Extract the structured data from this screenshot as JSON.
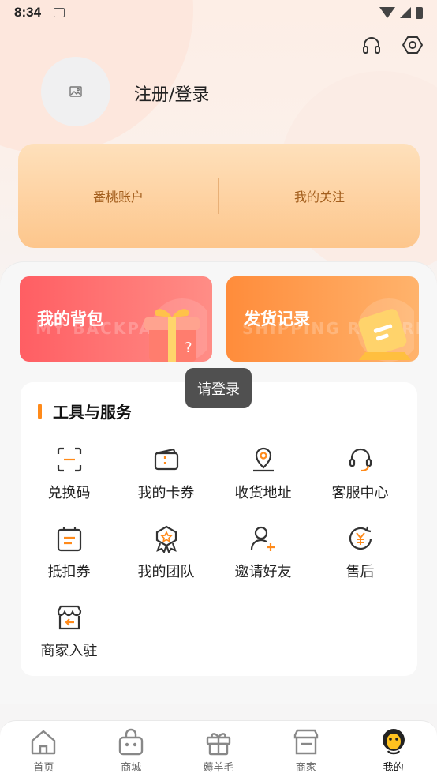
{
  "status_bar": {
    "time": "8:34"
  },
  "profile": {
    "login_label": "注册/登录"
  },
  "account_card": {
    "items": [
      "番桃账户",
      "我的关注"
    ]
  },
  "promos": {
    "backpack": {
      "title": "我的背包",
      "watermark": "MY BACKPACK"
    },
    "shipping": {
      "title": "发货记录",
      "watermark": "SHIPPING RECORD"
    }
  },
  "toast": "请登录",
  "tools": {
    "title": "工具与服务",
    "items": [
      {
        "label": "兑换码",
        "icon": "scan-code-icon"
      },
      {
        "label": "我的卡券",
        "icon": "ticket-icon"
      },
      {
        "label": "收货地址",
        "icon": "location-pin-icon"
      },
      {
        "label": "客服中心",
        "icon": "headset-icon"
      },
      {
        "label": "抵扣券",
        "icon": "calendar-voucher-icon"
      },
      {
        "label": "我的团队",
        "icon": "badge-team-icon"
      },
      {
        "label": "邀请好友",
        "icon": "add-user-icon"
      },
      {
        "label": "售后",
        "icon": "refund-yen-icon"
      },
      {
        "label": "商家入驻",
        "icon": "shop-enter-icon"
      }
    ]
  },
  "tabbar": {
    "items": [
      {
        "label": "首页",
        "icon": "home-icon"
      },
      {
        "label": "商城",
        "icon": "shopping-bag-icon"
      },
      {
        "label": "薅羊毛",
        "icon": "gift-icon"
      },
      {
        "label": "商家",
        "icon": "store-icon"
      },
      {
        "label": "我的",
        "icon": "mascot-profile-icon",
        "active": true
      }
    ]
  },
  "colors": {
    "accent": "#ff8a1a",
    "account_text": "#a35e1d",
    "backpack_red": "#ff5e63",
    "shipping_orange": "#ff8c3b",
    "toast_bg": "#505050"
  }
}
